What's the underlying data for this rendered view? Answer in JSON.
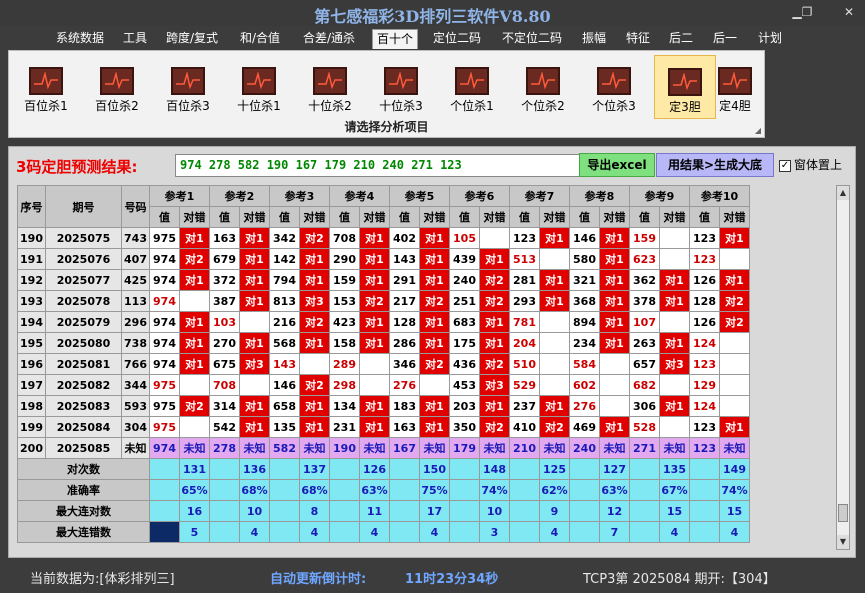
{
  "window": {
    "title": "第七感福彩3D排列三软件V8.80"
  },
  "menu": [
    "系统数据",
    "工具",
    "跨度/复式",
    "和/合值",
    "合差/通杀",
    "百十个",
    "定位二码",
    "不定位二码",
    "振幅",
    "特征",
    "后二",
    "后一",
    "计划"
  ],
  "ribbon": {
    "buttons": [
      "百位杀1",
      "百位杀2",
      "百位杀3",
      "十位杀1",
      "十位杀2",
      "十位杀3",
      "个位杀1",
      "个位杀2",
      "个位杀3",
      "定3胆",
      "定4胆"
    ],
    "caption": "请选择分析项目"
  },
  "result": {
    "label": "3码定胆预测结果:",
    "value": "974  278  582  190  167  179  210  240  271  123",
    "excel_button": "导出excel",
    "big_button": "用结果>生成大底",
    "topmost_label": "窗体置上",
    "topmost_checked": "✓"
  },
  "table": {
    "head": {
      "seq": "序号",
      "period": "期号",
      "number": "号码"
    },
    "refs": [
      "参考1",
      "参考2",
      "参考3",
      "参考4",
      "参考5",
      "参考6",
      "参考7",
      "参考8",
      "参考9",
      "参考10"
    ],
    "sub": [
      "值",
      "对错"
    ],
    "rows": [
      {
        "seq": "190",
        "period": "2025075",
        "number": "743",
        "cells": [
          [
            "975",
            "对1"
          ],
          [
            "163",
            "对1"
          ],
          [
            "342",
            "对2"
          ],
          [
            "708",
            "对1"
          ],
          [
            "402",
            "对1"
          ],
          [
            "105",
            ""
          ],
          [
            "123",
            "对1"
          ],
          [
            "146",
            "对1"
          ],
          [
            "159",
            ""
          ],
          [
            "123",
            "对1"
          ]
        ]
      },
      {
        "seq": "191",
        "period": "2025076",
        "number": "407",
        "cells": [
          [
            "974",
            "对2"
          ],
          [
            "679",
            "对1"
          ],
          [
            "142",
            "对1"
          ],
          [
            "290",
            "对1"
          ],
          [
            "143",
            "对1"
          ],
          [
            "439",
            "对1"
          ],
          [
            "513",
            ""
          ],
          [
            "580",
            "对1"
          ],
          [
            "623",
            ""
          ],
          [
            "123",
            ""
          ]
        ]
      },
      {
        "seq": "192",
        "period": "2025077",
        "number": "425",
        "cells": [
          [
            "974",
            "对1"
          ],
          [
            "372",
            "对1"
          ],
          [
            "794",
            "对1"
          ],
          [
            "159",
            "对1"
          ],
          [
            "291",
            "对1"
          ],
          [
            "240",
            "对2"
          ],
          [
            "281",
            "对1"
          ],
          [
            "321",
            "对1"
          ],
          [
            "362",
            "对1"
          ],
          [
            "126",
            "对1"
          ]
        ]
      },
      {
        "seq": "193",
        "period": "2025078",
        "number": "113",
        "cells": [
          [
            "974",
            ""
          ],
          [
            "387",
            "对1"
          ],
          [
            "813",
            "对3"
          ],
          [
            "153",
            "对2"
          ],
          [
            "217",
            "对2"
          ],
          [
            "251",
            "对2"
          ],
          [
            "293",
            "对1"
          ],
          [
            "368",
            "对1"
          ],
          [
            "378",
            "对1"
          ],
          [
            "128",
            "对2"
          ]
        ]
      },
      {
        "seq": "194",
        "period": "2025079",
        "number": "296",
        "cells": [
          [
            "974",
            "对1"
          ],
          [
            "103",
            ""
          ],
          [
            "216",
            "对2"
          ],
          [
            "423",
            "对1"
          ],
          [
            "128",
            "对1"
          ],
          [
            "683",
            "对1"
          ],
          [
            "781",
            ""
          ],
          [
            "894",
            "对1"
          ],
          [
            "107",
            ""
          ],
          [
            "126",
            "对2"
          ]
        ]
      },
      {
        "seq": "195",
        "period": "2025080",
        "number": "738",
        "cells": [
          [
            "974",
            "对1"
          ],
          [
            "270",
            "对1"
          ],
          [
            "568",
            "对1"
          ],
          [
            "158",
            "对1"
          ],
          [
            "286",
            "对1"
          ],
          [
            "175",
            "对1"
          ],
          [
            "204",
            ""
          ],
          [
            "234",
            "对1"
          ],
          [
            "263",
            "对1"
          ],
          [
            "124",
            ""
          ]
        ]
      },
      {
        "seq": "196",
        "period": "2025081",
        "number": "766",
        "cells": [
          [
            "974",
            "对1"
          ],
          [
            "675",
            "对3"
          ],
          [
            "143",
            ""
          ],
          [
            "289",
            ""
          ],
          [
            "346",
            "对2"
          ],
          [
            "436",
            "对2"
          ],
          [
            "510",
            ""
          ],
          [
            "584",
            ""
          ],
          [
            "657",
            "对3"
          ],
          [
            "123",
            ""
          ]
        ]
      },
      {
        "seq": "197",
        "period": "2025082",
        "number": "344",
        "cells": [
          [
            "975",
            ""
          ],
          [
            "708",
            ""
          ],
          [
            "146",
            "对2"
          ],
          [
            "298",
            ""
          ],
          [
            "276",
            ""
          ],
          [
            "453",
            "对3"
          ],
          [
            "529",
            ""
          ],
          [
            "602",
            ""
          ],
          [
            "682",
            ""
          ],
          [
            "129",
            ""
          ]
        ]
      },
      {
        "seq": "198",
        "period": "2025083",
        "number": "593",
        "cells": [
          [
            "975",
            "对2"
          ],
          [
            "314",
            "对1"
          ],
          [
            "658",
            "对1"
          ],
          [
            "134",
            "对1"
          ],
          [
            "183",
            "对1"
          ],
          [
            "203",
            "对1"
          ],
          [
            "237",
            "对1"
          ],
          [
            "276",
            ""
          ],
          [
            "306",
            "对1"
          ],
          [
            "124",
            ""
          ]
        ]
      },
      {
        "seq": "199",
        "period": "2025084",
        "number": "304",
        "cells": [
          [
            "975",
            ""
          ],
          [
            "542",
            "对1"
          ],
          [
            "135",
            "对1"
          ],
          [
            "231",
            "对1"
          ],
          [
            "163",
            "对1"
          ],
          [
            "350",
            "对2"
          ],
          [
            "410",
            "对2"
          ],
          [
            "469",
            "对1"
          ],
          [
            "528",
            ""
          ],
          [
            "123",
            "对1"
          ]
        ]
      }
    ],
    "prediction": {
      "seq": "200",
      "period": "2025085",
      "number": "未知",
      "cells": [
        [
          "974",
          "未知"
        ],
        [
          "278",
          "未知"
        ],
        [
          "582",
          "未知"
        ],
        [
          "190",
          "未知"
        ],
        [
          "167",
          "未知"
        ],
        [
          "179",
          "未知"
        ],
        [
          "210",
          "未知"
        ],
        [
          "240",
          "未知"
        ],
        [
          "271",
          "未知"
        ],
        [
          "123",
          "未知"
        ]
      ]
    },
    "stats": [
      {
        "label": "对次数",
        "values": [
          "131",
          "136",
          "137",
          "126",
          "150",
          "148",
          "125",
          "127",
          "135",
          "149"
        ]
      },
      {
        "label": "准确率",
        "values": [
          "65%",
          "68%",
          "68%",
          "63%",
          "75%",
          "74%",
          "62%",
          "63%",
          "67%",
          "74%"
        ]
      },
      {
        "label": "最大连对数",
        "values": [
          "16",
          "10",
          "8",
          "11",
          "17",
          "10",
          "9",
          "12",
          "15",
          "15"
        ]
      },
      {
        "label": "最大连错数",
        "values": [
          "5",
          "4",
          "4",
          "4",
          "4",
          "3",
          "4",
          "7",
          "4",
          "4"
        ]
      }
    ]
  },
  "status": {
    "current": "当前数据为:[体彩排列三]",
    "countdown_label": "自动更新倒计时:",
    "countdown": "11时23分34秒",
    "draw": "TCP3第 2025084 期开:【304】"
  },
  "colors": {
    "hit": "#e00000",
    "miss": "#c00000",
    "prediction_row": "#e2a8f0",
    "stats_row": "#7fe8f2",
    "title": "#8fb4e8"
  }
}
